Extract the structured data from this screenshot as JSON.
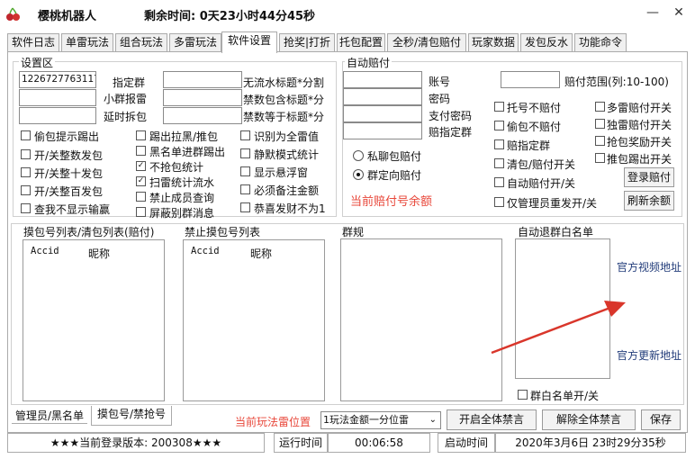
{
  "app": {
    "title": "樱桃机器人",
    "remaining": "剩余时间: 0天23小时44分45秒",
    "minimize": "—",
    "close": "✕"
  },
  "tabs": [
    "软件日志",
    "单雷玩法",
    "组合玩法",
    "多雷玩法",
    "软件设置",
    "抢奖|打折",
    "托包配置",
    "全秒/清包赔付",
    "玩家数据",
    "发包反水",
    "功能命令"
  ],
  "active_tab": "软件设置",
  "settings": {
    "group_label": "设置区",
    "qq_value": "12267277631178",
    "label_designated_group": "指定群",
    "label_small_report": "小群报雷",
    "label_delay_split": "延时拆包",
    "label_no_water_split": "无流水标题*分割",
    "label_ban_contains": "禁数包含标题*分",
    "label_ban_equals": "禁数等于标题*分",
    "checkboxes_col1": [
      {
        "label": "偷包提示踢出",
        "checked": false
      },
      {
        "label": "开/关整数发包",
        "checked": false
      },
      {
        "label": "开/关整十发包",
        "checked": false
      },
      {
        "label": "开/关整百发包",
        "checked": false
      },
      {
        "label": "查我不显示输赢",
        "checked": false
      }
    ],
    "checkboxes_col2": [
      {
        "label": "踢出拉黑/推包",
        "checked": false
      },
      {
        "label": "黑名单进群踢出",
        "checked": false
      },
      {
        "label": "不抢包统计",
        "checked": true
      },
      {
        "label": "扫雷统计流水",
        "checked": true
      },
      {
        "label": "禁止成员查询",
        "checked": false
      },
      {
        "label": "屏蔽别群消息",
        "checked": false
      }
    ],
    "checkboxes_col3": [
      {
        "label": "识别为全雷值",
        "checked": false
      },
      {
        "label": "静默模式统计",
        "checked": false
      },
      {
        "label": "显示悬浮窗",
        "checked": false
      },
      {
        "label": "必须备注金额",
        "checked": false
      },
      {
        "label": "恭喜发财不为1",
        "checked": false
      }
    ]
  },
  "auto_pay": {
    "group_label": "自动赔付",
    "label_account": "账号",
    "label_password": "密码",
    "label_pay_password": "支付密码",
    "label_pay_group": "赔指定群",
    "label_range": "赔付范围(列:10-100)",
    "radio_private": "私聊包赔付",
    "radio_group": "群定向赔付",
    "balance_label": "当前赔付号余额",
    "checkboxes_mid": [
      "托号不赔付",
      "偷包不赔付",
      "赔指定群",
      "清包/赔付开关",
      "自动赔付开/关",
      "仅管理员重发开/关"
    ],
    "checkboxes_right": [
      "多雷赔付开关",
      "独雷赔付开关",
      "抢包奖励开关",
      "推包踢出开关"
    ],
    "btn_login": "登录赔付",
    "btn_refresh": "刷新余额"
  },
  "lists": {
    "touch_list_label": "摸包号列表/清包列表(赔付)",
    "ban_list_label": "禁止摸包号列表",
    "col_id": "Accid",
    "col_nick": "昵称",
    "group_rules_label": "群规",
    "whitelist_label": "自动退群白名单",
    "whitelist_toggle": "群白名单开/关"
  },
  "links": {
    "video": "官方视频地址",
    "update": "官方更新地址"
  },
  "bottom": {
    "subtab_admin": "管理员/黑名单",
    "subtab_touch": "摸包号/禁抢号",
    "mode_label": "当前玩法雷位置",
    "mode_value": "1玩法金额一分位雷",
    "btn_mute_all": "开启全体禁言",
    "btn_unmute_all": "解除全体禁言",
    "btn_save": "保存"
  },
  "status": {
    "version": "★★★当前登录版本: 200308★★★",
    "runtime_label": "运行时间",
    "runtime_value": "00:06:58",
    "start_label": "启动时间",
    "start_value": "2020年3月6日 23时29分35秒"
  },
  "colors": {
    "red_text": "#e8473a",
    "link_blue": "#223c7a",
    "arrow_red": "#d9362b"
  }
}
